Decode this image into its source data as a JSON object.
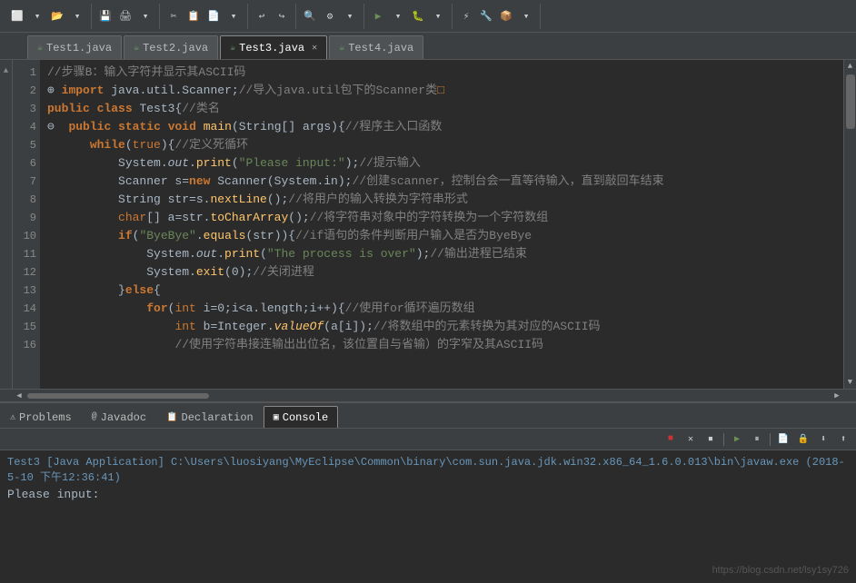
{
  "toolbar": {
    "groups": [
      [
        "⬜",
        "▶",
        "⟳"
      ],
      [
        "📁",
        "💾",
        "🖨"
      ],
      [
        "✂",
        "📋",
        "📄"
      ],
      [
        "↩",
        "↪"
      ],
      [
        "🔍",
        "⚙"
      ],
      [
        "▶",
        "⏸",
        "⏹"
      ],
      [
        "🐛"
      ],
      [
        "📦",
        "🔧"
      ]
    ]
  },
  "tabs": [
    {
      "label": "Test1.java",
      "icon": "☕",
      "active": false,
      "closable": false
    },
    {
      "label": "Test2.java",
      "icon": "☕",
      "active": false,
      "closable": false
    },
    {
      "label": "Test3.java",
      "icon": "☕",
      "active": true,
      "closable": true
    },
    {
      "label": "Test4.java",
      "icon": "☕",
      "active": false,
      "closable": false
    }
  ],
  "code": {
    "lines": [
      "    <span class='comment'>//步骤B：输入字符并显示其ASCII码</span>",
      "  <span class='kw'>import</span> java.util.Scanner;<span class='comment'>//导入java.util包下的Scanner类</span><span style='color:#cc7832'>□</span>",
      "  <span class='kw'>public</span> <span class='kw'>class</span> Test3{<span class='comment'>//类名</span>",
      "    <span class='kw'>public</span> <span class='kw'>static</span> <span class='kw'>void</span> <span class='fn'>main</span>(String[] args){<span class='comment'>//程序主入口函数</span>",
      "      <span class='kw'>while</span>(<span class='kw2'>true</span>){<span class='comment'>//定义死循环</span>",
      "        System.<span class='method italic'>out</span>.<span class='fn'>print</span>(<span class='str'>\"Please input:\"</span>);<span class='comment'>//提示输入</span>",
      "        Scanner s=<span class='kw'>new</span> Scanner(System.in);<span class='comment'>//创建scanner，控制台会一直等待输入，直到敲回车结束</span>",
      "        String str=s.<span class='fn'>nextLine</span>();<span class='comment'>//将用户的输入转换为字符串形式</span>",
      "        <span class='kw2'>char</span>[] a=str.<span class='fn'>toCharArray</span>();<span class='comment'>//将字符串对象中的字符转换为一个字符数组</span>",
      "        <span class='kw'>if</span>(<span class='str'>\"ByeBye\"</span>.<span class='fn'>equals</span>(str)){<span class='comment'>//if语句的条件判断用户输入是否为ByeBye</span>",
      "          System.<span class='method italic'>out</span>.<span class='fn'>print</span>(<span class='str'>\"The process is over\"</span>);<span class='comment'>//输出进程已结束</span>",
      "          System.<span class='fn'>exit</span>(0);<span class='comment'>//关闭进程</span>",
      "        }<span class='kw'>else</span>{",
      "          <span class='kw'>for</span>(<span class='kw2'>int</span> i=0;i&lt;a.length;i++){<span class='comment'>//使用for循环遍历数组</span>",
      "            <span class='kw2'>int</span> b=Integer.<span class='fn italic'>valueOf</span>(a[i]);<span class='comment'>//将数组中的元素转换为其对应的ASCII码</span>",
      "            <span class='comment'>//使用字符串接连输出出位名，该位置自与省输）的字窄及其ASCII码</span>"
    ],
    "lineNumbers": [
      "1",
      "2",
      "3",
      "4",
      "5",
      "6",
      "7",
      "8",
      "9",
      "10",
      "11",
      "12",
      "13",
      "14",
      "15",
      "16"
    ]
  },
  "bottomTabs": [
    {
      "label": "Problems",
      "icon": "⚠",
      "active": false
    },
    {
      "label": "Javadoc",
      "icon": "@",
      "active": false
    },
    {
      "label": "Declaration",
      "icon": "📋",
      "active": false
    },
    {
      "label": "Console",
      "icon": "▣",
      "active": true
    }
  ],
  "bottomToolbar": {
    "buttons": [
      "🔴",
      "❌",
      "⏹",
      "▶",
      "⏸",
      "📄",
      "🔒",
      "⬇",
      "⬆"
    ]
  },
  "console": {
    "title": "Test3 [Java Application] C:\\Users\\luosiyang\\MyEclipse\\Common\\binary\\com.sun.java.jdk.win32.x86_64_1.6.0.013\\bin\\javaw.exe (2018-5-10 下午12:36:41)",
    "output": "Please input:"
  },
  "watermark": "https://blog.csdn.net/lsy1sy726"
}
